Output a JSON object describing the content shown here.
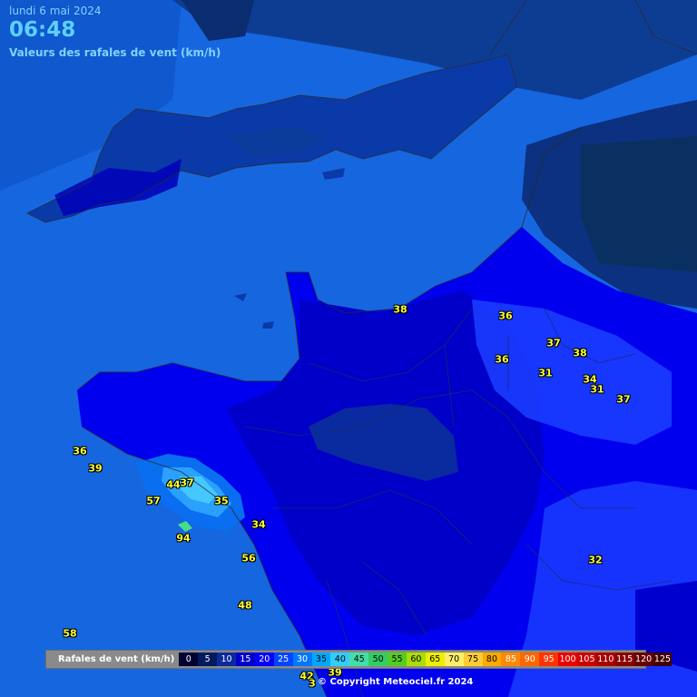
{
  "header": {
    "date": "lundi 6 mai 2024",
    "time": "06:48",
    "subtitle": "Valeurs des rafales de vent (km/h)"
  },
  "gusts": [
    {
      "value": "38",
      "name": "gust-label"
    },
    {
      "value": "36",
      "name": "gust-label"
    },
    {
      "value": "37",
      "name": "gust-label"
    },
    {
      "value": "38",
      "name": "gust-label"
    },
    {
      "value": "36",
      "name": "gust-label"
    },
    {
      "value": "31",
      "name": "gust-label"
    },
    {
      "value": "34",
      "name": "gust-label"
    },
    {
      "value": "31",
      "name": "gust-label"
    },
    {
      "value": "37",
      "name": "gust-label"
    },
    {
      "value": "36",
      "name": "gust-label"
    },
    {
      "value": "39",
      "name": "gust-label"
    },
    {
      "value": "44",
      "name": "gust-label"
    },
    {
      "value": "37",
      "name": "gust-label"
    },
    {
      "value": "35",
      "name": "gust-label"
    },
    {
      "value": "57",
      "name": "gust-label"
    },
    {
      "value": "34",
      "name": "gust-label"
    },
    {
      "value": "94",
      "name": "gust-label"
    },
    {
      "value": "56",
      "name": "gust-label"
    },
    {
      "value": "32",
      "name": "gust-label"
    },
    {
      "value": "48",
      "name": "gust-label"
    },
    {
      "value": "58",
      "name": "gust-label"
    },
    {
      "value": "42",
      "name": "gust-label"
    },
    {
      "value": "39",
      "name": "gust-label"
    },
    {
      "value": "3",
      "name": "gust-label"
    }
  ],
  "legend": {
    "title": "Rafales de vent (km/h)",
    "entries": [
      {
        "label": "0",
        "color": "#000033"
      },
      {
        "label": "5",
        "color": "#001a5e"
      },
      {
        "label": "10",
        "color": "#0a2a9e"
      },
      {
        "label": "15",
        "color": "#0000cc"
      },
      {
        "label": "20",
        "color": "#0000ff"
      },
      {
        "label": "25",
        "color": "#0044ff"
      },
      {
        "label": "30",
        "color": "#0077ff"
      },
      {
        "label": "35",
        "color": "#00a8ff"
      },
      {
        "label": "40",
        "color": "#33ccff"
      },
      {
        "label": "45",
        "color": "#44ddaa"
      },
      {
        "label": "50",
        "color": "#33cc66"
      },
      {
        "label": "55",
        "color": "#55cc22"
      },
      {
        "label": "60",
        "color": "#aadd00"
      },
      {
        "label": "65",
        "color": "#eeee00"
      },
      {
        "label": "70",
        "color": "#ffee66"
      },
      {
        "label": "75",
        "color": "#ffcc33"
      },
      {
        "label": "80",
        "color": "#ffaa00"
      },
      {
        "label": "85",
        "color": "#ff8800"
      },
      {
        "label": "90",
        "color": "#ff6600"
      },
      {
        "label": "95",
        "color": "#ff3300"
      },
      {
        "label": "100",
        "color": "#ee0000"
      },
      {
        "label": "105",
        "color": "#cc0000"
      },
      {
        "label": "110",
        "color": "#aa0000"
      },
      {
        "label": "115",
        "color": "#880000"
      },
      {
        "label": "120",
        "color": "#660000"
      },
      {
        "label": "125",
        "color": "#440000"
      }
    ]
  },
  "copyright": "© Copyright Meteociel.fr 2024"
}
